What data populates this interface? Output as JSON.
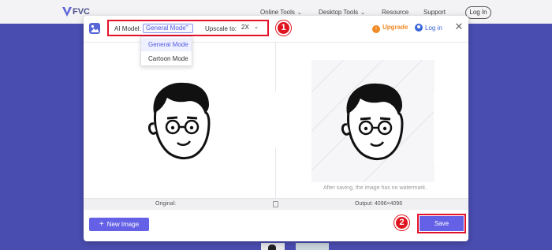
{
  "site": {
    "logo_text": "FVC",
    "nav": [
      "Online Tools",
      "Desktop Tools",
      "Resource",
      "Support"
    ],
    "login": "Log In"
  },
  "modal": {
    "ai_model_label": "AI Model:",
    "ai_model_value": "General Mode",
    "upscale_label": "Upscale to:",
    "upscale_value": "2X",
    "dropdown_options": [
      "General Mode",
      "Cartoon Mode"
    ],
    "upgrade": "Upgrade",
    "login": "Log in",
    "close": "✕",
    "watermark_note": "After saving, the image has no watermark.",
    "original_label": "Original:",
    "output_label": "Output: 4096×4096",
    "new_image": "New Image",
    "save": "Save",
    "step1": "1",
    "step2": "2"
  },
  "colors": {
    "brand_purple": "#6461e6",
    "hero": "#4a4db0",
    "highlight_red": "#e3102a",
    "upgrade_orange": "#f08a24",
    "login_blue": "#3a66d8"
  }
}
